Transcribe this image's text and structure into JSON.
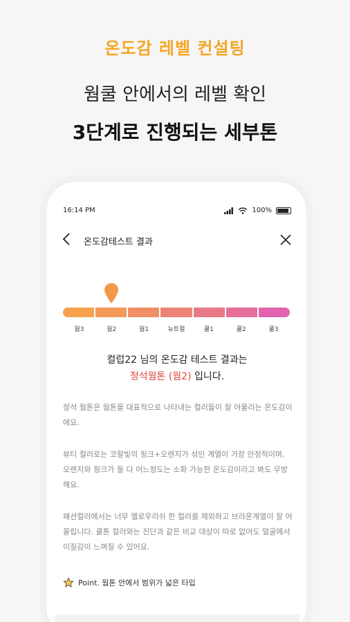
{
  "promo": {
    "eyebrow": "온도감 레벨 컨설팅",
    "line1": "웜쿨 안에서의 레벨 확인",
    "line2": "3단계로 진행되는 세부톤"
  },
  "status_bar": {
    "time": "16:14 PM",
    "battery": "100%"
  },
  "nav": {
    "title": "온도감테스트 결과"
  },
  "scale": {
    "labels": [
      "웜3",
      "웜2",
      "웜1",
      "뉴트럴",
      "쿨1",
      "쿨2",
      "쿨3"
    ],
    "selected_index": 1,
    "colors": [
      "#f7a14e",
      "#f49a58",
      "#f08f66",
      "#ec8476",
      "#e87a88",
      "#e66f9b",
      "#e264ae"
    ]
  },
  "result": {
    "line1": "컬럽22 님의 온도감 테스트 결과는",
    "tone": "정석웜톤 (웜2)",
    "suffix": " 입니다."
  },
  "description": {
    "p1": "정석 웜톤은 웜톤을 대표적으로 나타내는 컬러들이 잘 어울리는 온도감이에요.",
    "p2": "뷰티 컬러로는 코랄빛의 핑크+오렌지가 섞인 계열이 가장 안정적이며, 오렌지와 핑크가 둘 다 어느정도는 소화 가능한 온도감이라고 봐도 무방해요.",
    "p3": "패션컬러에서는 너무 옐로우리쉬 한 컬러를 제외하고 브라운계열이 잘 어울립니다. 쿨톤 컬러와는 진단과 같은 비교 대상이 따로 없어도 얼굴에서 이질감이 느껴질 수 있어요."
  },
  "point": {
    "text": "Point. 웜톤 안에서 범위가 넓은 타입"
  },
  "colors": {
    "accent": "#f5a623",
    "highlight": "#e0453a",
    "pin": "#f2994a"
  }
}
